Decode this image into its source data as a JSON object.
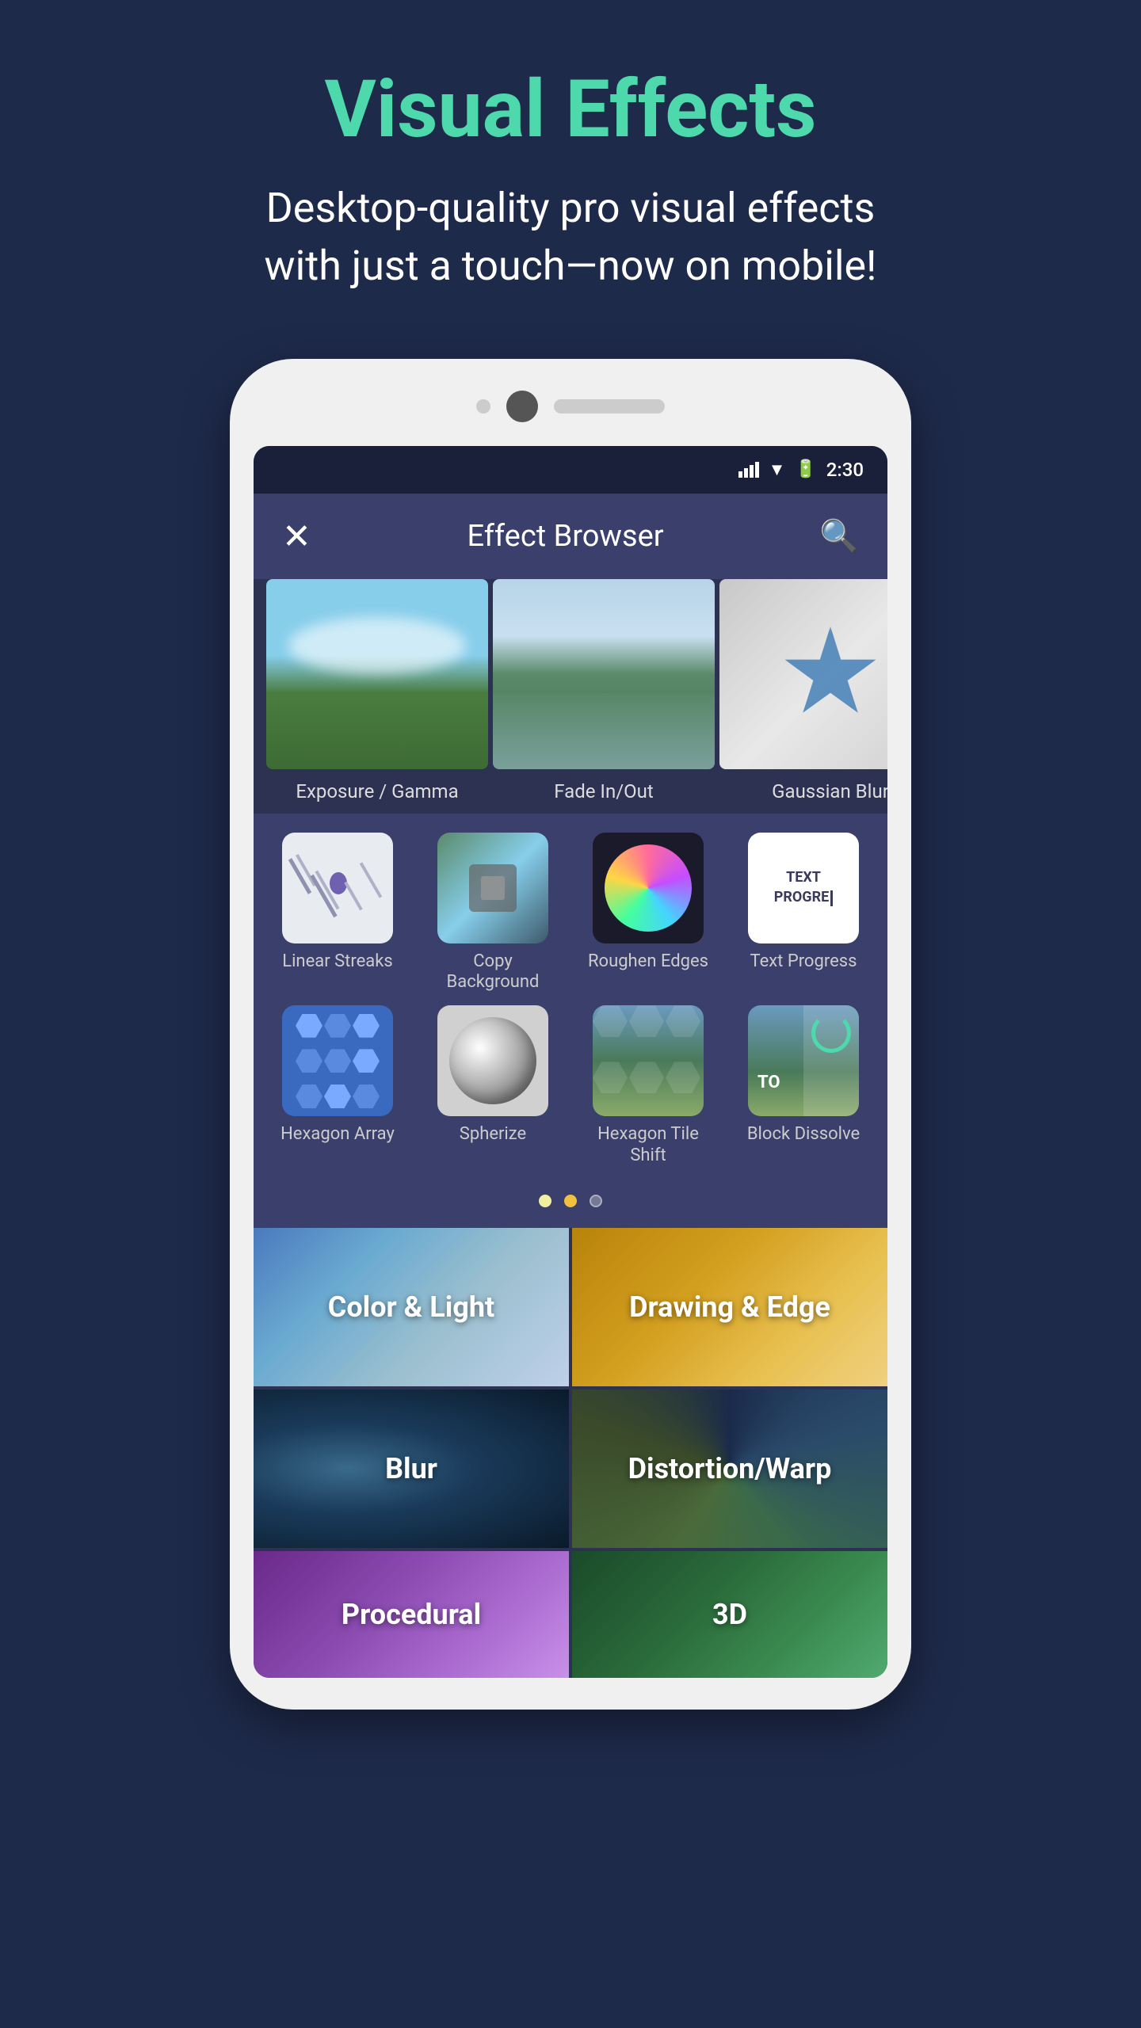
{
  "header": {
    "title": "Visual Effects",
    "subtitle": "Desktop-quality pro visual effects\nwith just a touch—now on mobile!"
  },
  "status_bar": {
    "time": "2:30"
  },
  "app_bar": {
    "title": "Effect Browser",
    "close_label": "✕",
    "search_label": "🔍"
  },
  "carousel": {
    "items": [
      {
        "label": "Exposure / Gamma"
      },
      {
        "label": "Fade In/Out"
      },
      {
        "label": "Gaussian Blur"
      }
    ]
  },
  "effects_row1": [
    {
      "label": "Linear Streaks"
    },
    {
      "label": "Copy Background"
    },
    {
      "label": "Roughen Edges"
    },
    {
      "label": "Text Progress"
    }
  ],
  "effects_row2": [
    {
      "label": "Hexagon Array"
    },
    {
      "label": "Spherize"
    },
    {
      "label": "Hexagon Tile Shift"
    },
    {
      "label": "Block Dissolve"
    }
  ],
  "pagination": {
    "dots": [
      "active",
      "star",
      "inactive"
    ]
  },
  "categories": [
    {
      "label": "Color & Light",
      "type": "color-light"
    },
    {
      "label": "Drawing & Edge",
      "type": "drawing"
    },
    {
      "label": "Blur",
      "type": "blur"
    },
    {
      "label": "Distortion/Warp",
      "type": "distortion"
    },
    {
      "label": "Procedural",
      "type": "procedural"
    },
    {
      "label": "3D",
      "type": "3d"
    }
  ]
}
